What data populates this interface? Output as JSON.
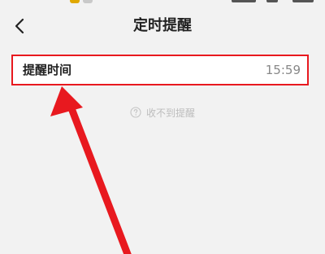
{
  "header": {
    "title": "定时提醒",
    "back_icon": "chevron-left-icon"
  },
  "reminder_row": {
    "label": "提醒时间",
    "value": "15:59"
  },
  "help": {
    "icon": "question-circle-icon",
    "text": "收不到提醒"
  },
  "colors": {
    "highlight": "#e8191f",
    "background": "#f2f2f2",
    "accent": "#e0a800"
  }
}
